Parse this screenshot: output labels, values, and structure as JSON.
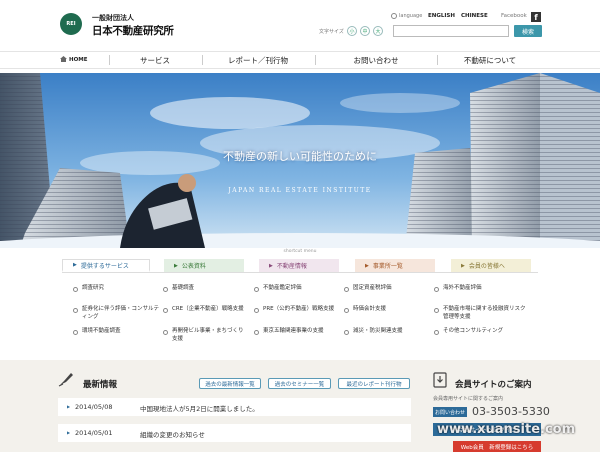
{
  "header": {
    "logo_text": "REI",
    "org_type": "一般財団法人",
    "org_name": "日本不動産研究所",
    "font_size_label": "文字サイズ",
    "font_sizes": [
      "小",
      "中",
      "大"
    ],
    "language_label": "language",
    "lang_en": "ENGLISH",
    "lang_cn": "CHINESE",
    "facebook_label": "Facebook",
    "facebook_icon": "f",
    "search_placeholder": "",
    "search_button": "検索"
  },
  "nav": {
    "home": "HOME",
    "items": [
      "サービス",
      "レポート／刊行物",
      "お問い合わせ",
      "不動研について"
    ]
  },
  "hero": {
    "tagline": "不動産の新しい可能性のために",
    "subtitle": "JAPAN REAL ESTATE INSTITUTE"
  },
  "shortcut": {
    "label": "shortcut menu",
    "tabs": [
      "提供するサービス",
      "公表資料",
      "不動産情報",
      "事業所一覧",
      "会員の皆様へ"
    ]
  },
  "services": {
    "col1": [
      "調査研究",
      "証券化に伴う評価・コンサルティング",
      "環境不動産調査"
    ],
    "col2": [
      "基礎調査",
      "CRE（企業不動産）戦略支援",
      "再開発ビル事業・まちづくり支援"
    ],
    "col3": [
      "不動産鑑定評価",
      "PRE（公的不動産）戦略支援",
      "東京五輪関連事業の支援"
    ],
    "col4": [
      "固定資産税評価",
      "時価会計支援",
      "減災・防災関連支援"
    ],
    "col5": [
      "海外不動産評価",
      "不動産市場に関する投融資リスク管理等支援",
      "その他コンサルティング"
    ]
  },
  "news": {
    "title": "最新情報",
    "buttons": [
      "過去の最新情報一覧",
      "過去のセミナー一覧",
      "最近のレポート刊行物"
    ],
    "items": [
      {
        "date": "2014/05/08",
        "text": "中国現地法人が5月2日に開業しました。"
      },
      {
        "date": "2014/05/01",
        "text": "組織の変更のお知らせ"
      }
    ]
  },
  "member": {
    "title": "会員サイトのご案内",
    "sub": "会員専用サイトに関するご案内",
    "badge": "お問い合わせ",
    "phone": "03-3503-5330",
    "login": "会員サイトへログイン",
    "signup": "Web会員　新規登録はこちら"
  },
  "watermark": "www.xuansite.com",
  "colors": {
    "brand_green": "#1f6b4f",
    "accent_blue": "#2c6a98",
    "search_button": "#3c97aa",
    "signup_red": "#d63b2e"
  }
}
